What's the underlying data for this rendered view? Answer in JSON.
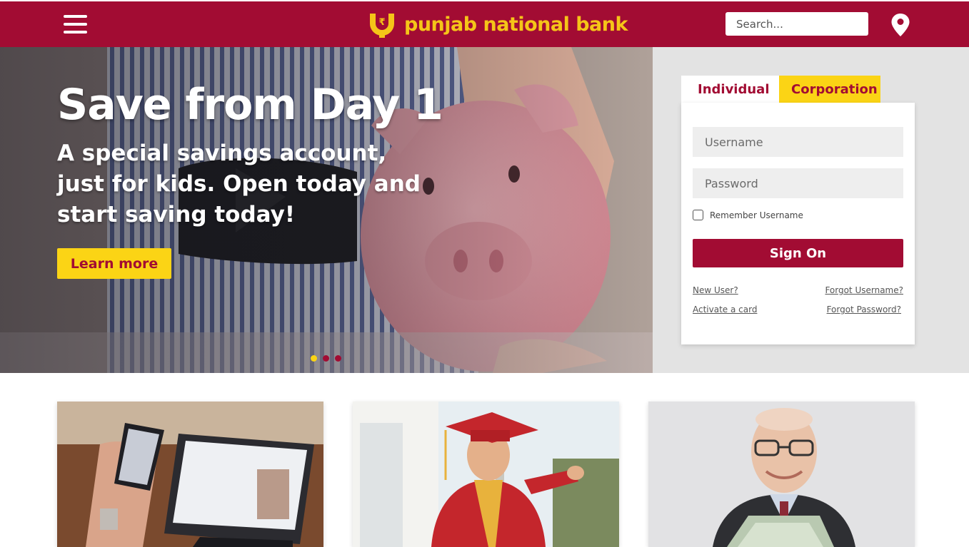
{
  "header": {
    "brand": "punjab national bank",
    "search_placeholder": "Search...",
    "icons": [
      "menu-icon",
      "rupee-logo-icon",
      "location-pin-icon"
    ],
    "colors": {
      "primary": "#a20c33",
      "accent": "#fbd415"
    }
  },
  "hero": {
    "title": "Save from Day 1",
    "subtitle": "A special savings account, just for kids. Open today and start saving today!",
    "cta": "Learn more",
    "slides": 3,
    "active_slide": 1
  },
  "login": {
    "tabs": [
      {
        "label": "Individual",
        "active": true
      },
      {
        "label": "Corporation",
        "active": false
      }
    ],
    "username_placeholder": "Username",
    "password_placeholder": "Password",
    "remember_label": "Remember Username",
    "remember_checked": false,
    "submit": "Sign On",
    "links": {
      "new_user": "New User?",
      "forgot_username": "Forgot Username?",
      "activate_card": "Activate a card",
      "forgot_password": "Forgot Password?"
    }
  },
  "cards": [
    {
      "image": "laptop-and-phone-photo"
    },
    {
      "image": "graduate-photo"
    },
    {
      "image": "senior-with-money-photo"
    }
  ]
}
